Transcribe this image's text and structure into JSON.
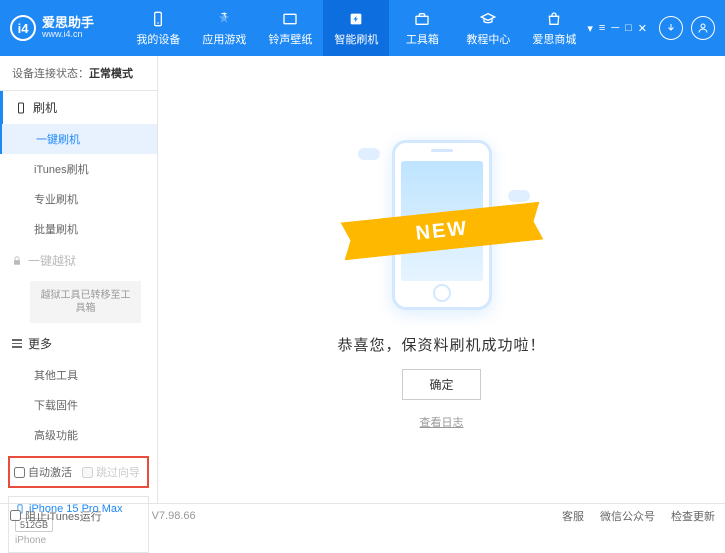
{
  "brand": {
    "name": "爱思助手",
    "url": "www.i4.cn",
    "logo_text": "i4"
  },
  "nav": [
    {
      "label": "我的设备"
    },
    {
      "label": "应用游戏"
    },
    {
      "label": "铃声壁纸"
    },
    {
      "label": "智能刷机",
      "active": true
    },
    {
      "label": "工具箱"
    },
    {
      "label": "教程中心"
    },
    {
      "label": "爱思商城"
    }
  ],
  "status": {
    "prefix": "设备连接状态：",
    "mode": "正常模式"
  },
  "sidebar": {
    "flash_header": "刷机",
    "items": [
      {
        "label": "一键刷机",
        "active": true
      },
      {
        "label": "iTunes刷机"
      },
      {
        "label": "专业刷机"
      },
      {
        "label": "批量刷机"
      }
    ],
    "jailbreak_header": "一键越狱",
    "jailbreak_note": "越狱工具已转移至工具箱",
    "more_header": "更多",
    "more_items": [
      {
        "label": "其他工具"
      },
      {
        "label": "下载固件"
      },
      {
        "label": "高级功能"
      }
    ],
    "checkboxes": {
      "auto_activate": "自动激活",
      "skip_guide": "跳过向导"
    }
  },
  "device": {
    "name": "iPhone 15 Pro Max",
    "storage": "512GB",
    "type": "iPhone"
  },
  "main": {
    "ribbon": "NEW",
    "success": "恭喜您，保资料刷机成功啦！",
    "ok": "确定",
    "view_log": "查看日志"
  },
  "footer": {
    "block_itunes": "阻止iTunes运行",
    "version": "V7.98.66",
    "links": [
      "客服",
      "微信公众号",
      "检查更新"
    ]
  }
}
